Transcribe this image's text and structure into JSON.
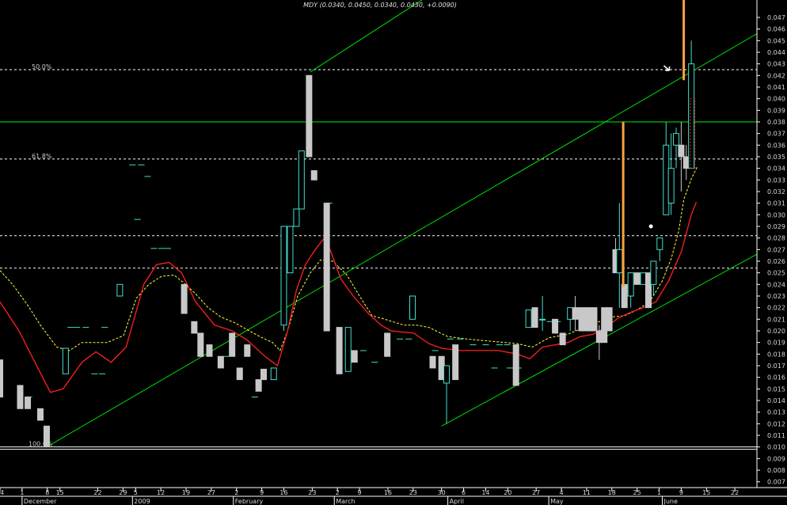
{
  "header": {
    "title": "MDY (0.0340, 0.0450, 0.0340, 0.0430, +0.0090)"
  },
  "chart_data": {
    "type": "candlestick",
    "title": "MDY (0.0340, 0.0450, 0.0340, 0.0430, +0.0090)",
    "ylim": [
      0.0065,
      0.0485
    ],
    "xlim": [
      0,
      60
    ],
    "y_ticks": [
      "0.047",
      "0.046",
      "0.045",
      "0.044",
      "0.043",
      "0.042",
      "0.041",
      "0.040",
      "0.039",
      "0.038",
      "0.037",
      "0.036",
      "0.035",
      "0.034",
      "0.033",
      "0.032",
      "0.031",
      "0.030",
      "0.029",
      "0.028",
      "0.027",
      "0.026",
      "0.025",
      "0.024",
      "0.023",
      "0.022",
      "0.021",
      "0.020",
      "0.019",
      "0.018",
      "0.017",
      "0.016",
      "0.015",
      "0.014",
      "0.013",
      "0.012",
      "0.011",
      "0.010",
      "0.009",
      "0.008",
      "0.007"
    ],
    "x_ticks": [
      {
        "label": "24",
        "x": 0
      },
      {
        "label": "1",
        "x": 1.75
      },
      {
        "label": "8",
        "x": 3.75
      },
      {
        "label": "15",
        "x": 4.75
      },
      {
        "label": "22",
        "x": 7.75
      },
      {
        "label": "29",
        "x": 9.75
      },
      {
        "label": "5",
        "x": 10.75
      },
      {
        "label": "12",
        "x": 12.75
      },
      {
        "label": "19",
        "x": 14.75
      },
      {
        "label": "27",
        "x": 16.75
      },
      {
        "label": "2",
        "x": 18.75
      },
      {
        "label": "9",
        "x": 20.75
      },
      {
        "label": "16",
        "x": 22.5
      },
      {
        "label": "23",
        "x": 24.75
      },
      {
        "label": "2",
        "x": 26.75
      },
      {
        "label": "9",
        "x": 28.5
      },
      {
        "label": "16",
        "x": 30.75
      },
      {
        "label": "23",
        "x": 32.75
      },
      {
        "label": "30",
        "x": 35
      },
      {
        "label": "6",
        "x": 36.75
      },
      {
        "label": "14",
        "x": 38.5
      },
      {
        "label": "20",
        "x": 40.25
      },
      {
        "label": "27",
        "x": 42.5
      },
      {
        "label": "4",
        "x": 44.5
      },
      {
        "label": "11",
        "x": 46.5
      },
      {
        "label": "18",
        "x": 48.5
      },
      {
        "label": "25",
        "x": 50.5
      },
      {
        "label": "1",
        "x": 52.25
      },
      {
        "label": "9",
        "x": 54
      },
      {
        "label": "15",
        "x": 56
      },
      {
        "label": "22",
        "x": 58.25
      }
    ],
    "month_labels": [
      {
        "label": "December",
        "x": 1.75
      },
      {
        "label": "2009",
        "x": 10.5
      },
      {
        "label": "February",
        "x": 18.5
      },
      {
        "label": "March",
        "x": 26.5
      },
      {
        "label": "April",
        "x": 35.5
      },
      {
        "label": "May",
        "x": 43.5
      },
      {
        "label": "June",
        "x": 52.5
      }
    ],
    "candles": [
      {
        "x": 0,
        "o": 0.0175,
        "h": 0.0175,
        "c": 0.0143,
        "l": 0.0143
      },
      {
        "x": 1.6,
        "o": 0.0153,
        "h": 0.0153,
        "c": 0.0133,
        "l": 0.0133
      },
      {
        "x": 2.2,
        "o": 0.0143,
        "h": 0.0143,
        "c": 0.0133,
        "l": 0.0133
      },
      {
        "x": 3.2,
        "o": 0.0133,
        "h": 0.0133,
        "c": 0.0123,
        "l": 0.0123
      },
      {
        "x": 3.7,
        "o": 0.0118,
        "h": 0.0118,
        "c": 0.01,
        "l": 0.01
      },
      {
        "x": 5.2,
        "o": 0.0163,
        "h": 0.0185,
        "c": 0.0185,
        "l": 0.0163
      },
      {
        "x": 9.5,
        "o": 0.023,
        "h": 0.024,
        "c": 0.024,
        "l": 0.023
      },
      {
        "x": 14.6,
        "o": 0.024,
        "h": 0.024,
        "c": 0.0215,
        "l": 0.0215
      },
      {
        "x": 15.4,
        "o": 0.0208,
        "h": 0.0208,
        "c": 0.0198,
        "l": 0.0198
      },
      {
        "x": 15.9,
        "o": 0.0198,
        "h": 0.0198,
        "c": 0.0178,
        "l": 0.0178
      },
      {
        "x": 16.6,
        "o": 0.0188,
        "h": 0.0188,
        "c": 0.0178,
        "l": 0.0178
      },
      {
        "x": 17.5,
        "o": 0.0178,
        "h": 0.0178,
        "c": 0.0168,
        "l": 0.0168
      },
      {
        "x": 18.4,
        "o": 0.0198,
        "h": 0.0198,
        "c": 0.0178,
        "l": 0.0178
      },
      {
        "x": 19.0,
        "o": 0.0168,
        "h": 0.0168,
        "c": 0.0158,
        "l": 0.0158
      },
      {
        "x": 19.6,
        "o": 0.0188,
        "h": 0.0188,
        "c": 0.0178,
        "l": 0.0178
      },
      {
        "x": 20.5,
        "o": 0.0158,
        "h": 0.0158,
        "c": 0.0148,
        "l": 0.0148
      },
      {
        "x": 20.9,
        "o": 0.0167,
        "h": 0.0167,
        "c": 0.0158,
        "l": 0.0158
      },
      {
        "x": 21.7,
        "o": 0.0158,
        "h": 0.0158,
        "c": 0.0168,
        "l": 0.0158
      },
      {
        "x": 22.5,
        "o": 0.0205,
        "h": 0.029,
        "c": 0.029,
        "l": 0.02
      },
      {
        "x": 23.0,
        "o": 0.025,
        "h": 0.029,
        "c": 0.029,
        "l": 0.025
      },
      {
        "x": 23.5,
        "o": 0.029,
        "h": 0.0305,
        "c": 0.0305,
        "l": 0.029
      },
      {
        "x": 23.9,
        "o": 0.0305,
        "h": 0.0355,
        "c": 0.0355,
        "l": 0.0305
      },
      {
        "x": 24.5,
        "o": 0.042,
        "h": 0.042,
        "c": 0.035,
        "l": 0.035
      },
      {
        "x": 24.9,
        "o": 0.0338,
        "h": 0.0338,
        "c": 0.033,
        "l": 0.033
      },
      {
        "x": 25.9,
        "o": 0.031,
        "h": 0.031,
        "c": 0.02,
        "l": 0.02
      },
      {
        "x": 26.9,
        "o": 0.0203,
        "h": 0.0203,
        "c": 0.0163,
        "l": 0.0163
      },
      {
        "x": 27.6,
        "o": 0.0165,
        "h": 0.0203,
        "c": 0.0203,
        "l": 0.0165
      },
      {
        "x": 28.1,
        "o": 0.0183,
        "h": 0.0183,
        "c": 0.0173,
        "l": 0.0173
      },
      {
        "x": 30.7,
        "o": 0.0198,
        "h": 0.0198,
        "c": 0.0178,
        "l": 0.0178
      },
      {
        "x": 32.7,
        "o": 0.021,
        "h": 0.023,
        "c": 0.023,
        "l": 0.021
      },
      {
        "x": 34.3,
        "o": 0.0178,
        "h": 0.0178,
        "c": 0.0168,
        "l": 0.0168
      },
      {
        "x": 35.0,
        "o": 0.0178,
        "h": 0.0178,
        "c": 0.0158,
        "l": 0.0158
      },
      {
        "x": 35.4,
        "o": 0.0155,
        "h": 0.017,
        "c": 0.017,
        "l": 0.012
      },
      {
        "x": 36.1,
        "o": 0.0188,
        "h": 0.0188,
        "c": 0.0158,
        "l": 0.0158
      },
      {
        "x": 40.9,
        "o": 0.0188,
        "h": 0.0188,
        "c": 0.0153,
        "l": 0.0153
      },
      {
        "x": 41.9,
        "o": 0.0203,
        "h": 0.0218,
        "c": 0.0218,
        "l": 0.0203
      },
      {
        "x": 42.4,
        "o": 0.022,
        "h": 0.022,
        "c": 0.0203,
        "l": 0.0203
      },
      {
        "x": 43.0,
        "o": 0.021,
        "h": 0.023,
        "c": 0.021,
        "l": 0.02
      },
      {
        "x": 44.0,
        "o": 0.021,
        "h": 0.021,
        "c": 0.0198,
        "l": 0.0198
      },
      {
        "x": 44.6,
        "o": 0.0198,
        "h": 0.0198,
        "c": 0.0188,
        "l": 0.0188
      },
      {
        "x": 45.2,
        "o": 0.021,
        "h": 0.022,
        "c": 0.022,
        "l": 0.02
      },
      {
        "x": 45.6,
        "o": 0.022,
        "h": 0.023,
        "c": 0.021,
        "l": 0.02
      },
      {
        "x": 46.1,
        "o": 0.022,
        "h": 0.022,
        "c": 0.02,
        "l": 0.02
      },
      {
        "x": 46.6,
        "o": 0.022,
        "h": 0.022,
        "c": 0.02,
        "l": 0.02
      },
      {
        "x": 47.1,
        "o": 0.022,
        "h": 0.022,
        "c": 0.02,
        "l": 0.02
      },
      {
        "x": 47.5,
        "o": 0.02,
        "h": 0.0205,
        "c": 0.019,
        "l": 0.0175
      },
      {
        "x": 47.9,
        "o": 0.022,
        "h": 0.022,
        "c": 0.019,
        "l": 0.019
      },
      {
        "x": 48.3,
        "o": 0.022,
        "h": 0.022,
        "c": 0.02,
        "l": 0.02
      },
      {
        "x": 48.8,
        "o": 0.027,
        "h": 0.028,
        "c": 0.025,
        "l": 0.025
      },
      {
        "x": 49.1,
        "o": 0.025,
        "h": 0.031,
        "c": 0.027,
        "l": 0.022
      },
      {
        "x": 49.5,
        "o": 0.024,
        "h": 0.024,
        "c": 0.022,
        "l": 0.022
      },
      {
        "x": 50.0,
        "o": 0.023,
        "h": 0.025,
        "c": 0.025,
        "l": 0.022
      },
      {
        "x": 50.5,
        "o": 0.025,
        "h": 0.025,
        "c": 0.024,
        "l": 0.024
      },
      {
        "x": 51.0,
        "o": 0.024,
        "h": 0.025,
        "c": 0.025,
        "l": 0.024
      },
      {
        "x": 51.4,
        "o": 0.025,
        "h": 0.025,
        "c": 0.022,
        "l": 0.022
      },
      {
        "x": 51.8,
        "o": 0.024,
        "h": 0.026,
        "c": 0.026,
        "l": 0.023
      },
      {
        "x": 52.3,
        "o": 0.027,
        "h": 0.028,
        "c": 0.028,
        "l": 0.026
      },
      {
        "x": 52.8,
        "o": 0.03,
        "h": 0.038,
        "c": 0.036,
        "l": 0.03
      },
      {
        "x": 53.2,
        "o": 0.031,
        "h": 0.037,
        "c": 0.034,
        "l": 0.03
      },
      {
        "x": 53.6,
        "o": 0.036,
        "h": 0.0375,
        "c": 0.037,
        "l": 0.034
      },
      {
        "x": 54.0,
        "o": 0.036,
        "h": 0.038,
        "c": 0.035,
        "l": 0.032
      },
      {
        "x": 54.4,
        "o": 0.035,
        "h": 0.036,
        "c": 0.034,
        "l": 0.033
      },
      {
        "x": 54.8,
        "o": 0.034,
        "h": 0.045,
        "c": 0.043,
        "l": 0.034
      }
    ],
    "dashes": [
      {
        "x": 2.3,
        "y": 0.0143
      },
      {
        "x": 5.6,
        "y": 0.0203
      },
      {
        "x": 6.1,
        "y": 0.0203
      },
      {
        "x": 6.8,
        "y": 0.0203
      },
      {
        "x": 8.3,
        "y": 0.0203
      },
      {
        "x": 7.5,
        "y": 0.0163
      },
      {
        "x": 8.1,
        "y": 0.0163
      },
      {
        "x": 10.5,
        "y": 0.0343
      },
      {
        "x": 11.2,
        "y": 0.0343
      },
      {
        "x": 11.7,
        "y": 0.0333
      },
      {
        "x": 10.9,
        "y": 0.0296
      },
      {
        "x": 12.2,
        "y": 0.0271
      },
      {
        "x": 12.8,
        "y": 0.0271
      },
      {
        "x": 13.3,
        "y": 0.0271
      },
      {
        "x": 17.9,
        "y": 0.0178
      },
      {
        "x": 20.2,
        "y": 0.0143
      },
      {
        "x": 26.1,
        "y": 0.031
      },
      {
        "x": 28.8,
        "y": 0.0183
      },
      {
        "x": 29.7,
        "y": 0.0173
      },
      {
        "x": 31.7,
        "y": 0.0193
      },
      {
        "x": 32.4,
        "y": 0.0193
      },
      {
        "x": 34.5,
        "y": 0.0183
      },
      {
        "x": 35.7,
        "y": 0.0193
      },
      {
        "x": 36.5,
        "y": 0.0193
      },
      {
        "x": 37.5,
        "y": 0.0188
      },
      {
        "x": 38.5,
        "y": 0.0188
      },
      {
        "x": 39.6,
        "y": 0.0188
      },
      {
        "x": 40.2,
        "y": 0.0188
      },
      {
        "x": 41.1,
        "y": 0.0168
      },
      {
        "x": 39.2,
        "y": 0.0168
      },
      {
        "x": 40.4,
        "y": 0.0168
      },
      {
        "x": 43.6,
        "y": 0.0208
      },
      {
        "x": 44.2,
        "y": 0.0208
      }
    ],
    "ma_red": [
      [
        0,
        0.0225
      ],
      [
        1.5,
        0.02
      ],
      [
        3,
        0.0168
      ],
      [
        4,
        0.0147
      ],
      [
        5,
        0.015
      ],
      [
        6.5,
        0.0173
      ],
      [
        7.6,
        0.0182
      ],
      [
        8.8,
        0.0173
      ],
      [
        10,
        0.0186
      ],
      [
        11.4,
        0.024
      ],
      [
        12.4,
        0.0257
      ],
      [
        13.4,
        0.0259
      ],
      [
        14.4,
        0.025
      ],
      [
        15.5,
        0.0225
      ],
      [
        17,
        0.0205
      ],
      [
        18.4,
        0.02
      ],
      [
        19.6,
        0.0192
      ],
      [
        21,
        0.0178
      ],
      [
        22,
        0.017
      ],
      [
        22.8,
        0.02
      ],
      [
        23.5,
        0.0235
      ],
      [
        24.2,
        0.0257
      ],
      [
        25,
        0.027
      ],
      [
        25.7,
        0.028
      ],
      [
        26.2,
        0.0269
      ],
      [
        27,
        0.0245
      ],
      [
        28,
        0.023
      ],
      [
        29.2,
        0.0215
      ],
      [
        30.2,
        0.0205
      ],
      [
        31,
        0.02
      ],
      [
        32.8,
        0.0198
      ],
      [
        34,
        0.0189
      ],
      [
        35,
        0.0185
      ],
      [
        36.5,
        0.0183
      ],
      [
        38,
        0.0183
      ],
      [
        39.5,
        0.0183
      ],
      [
        41,
        0.018
      ],
      [
        42,
        0.0176
      ],
      [
        43,
        0.0186
      ],
      [
        44,
        0.0188
      ],
      [
        45,
        0.019
      ],
      [
        46,
        0.0195
      ],
      [
        47,
        0.0197
      ],
      [
        48,
        0.0203
      ],
      [
        49,
        0.0211
      ],
      [
        50,
        0.0216
      ],
      [
        51,
        0.022
      ],
      [
        52,
        0.0225
      ],
      [
        53,
        0.0243
      ],
      [
        54,
        0.0268
      ],
      [
        54.8,
        0.03
      ],
      [
        55.2,
        0.0311
      ]
    ],
    "ma_yellow": [
      [
        0,
        0.0252
      ],
      [
        1,
        0.024
      ],
      [
        2.2,
        0.0222
      ],
      [
        3.2,
        0.0205
      ],
      [
        4.5,
        0.0186
      ],
      [
        5.5,
        0.0183
      ],
      [
        6.5,
        0.019
      ],
      [
        7.5,
        0.019
      ],
      [
        8.5,
        0.019
      ],
      [
        9.8,
        0.0196
      ],
      [
        10.8,
        0.0228
      ],
      [
        11.8,
        0.024
      ],
      [
        12.8,
        0.0247
      ],
      [
        13.8,
        0.0248
      ],
      [
        14.5,
        0.0242
      ],
      [
        15.5,
        0.0232
      ],
      [
        16.5,
        0.022
      ],
      [
        17.5,
        0.0212
      ],
      [
        18.6,
        0.0207
      ],
      [
        19.6,
        0.0201
      ],
      [
        20.6,
        0.0195
      ],
      [
        21.6,
        0.019
      ],
      [
        22.2,
        0.0183
      ],
      [
        22.8,
        0.02
      ],
      [
        23.6,
        0.023
      ],
      [
        24.6,
        0.025
      ],
      [
        25.4,
        0.0261
      ],
      [
        26.4,
        0.026
      ],
      [
        27.5,
        0.0248
      ],
      [
        28.5,
        0.023
      ],
      [
        29.5,
        0.0213
      ],
      [
        30.5,
        0.021
      ],
      [
        32,
        0.0205
      ],
      [
        33,
        0.0205
      ],
      [
        34,
        0.0203
      ],
      [
        35.5,
        0.0195
      ],
      [
        37,
        0.0193
      ],
      [
        39,
        0.0191
      ],
      [
        41,
        0.0189
      ],
      [
        42.2,
        0.0186
      ],
      [
        43.5,
        0.0194
      ],
      [
        45,
        0.0197
      ],
      [
        46.3,
        0.0203
      ],
      [
        47.5,
        0.0208
      ],
      [
        48.5,
        0.0212
      ],
      [
        49.5,
        0.0213
      ],
      [
        50.5,
        0.0218
      ],
      [
        51.5,
        0.0225
      ],
      [
        52.5,
        0.0243
      ],
      [
        53.2,
        0.0262
      ],
      [
        53.8,
        0.0286
      ],
      [
        54.2,
        0.0313
      ],
      [
        54.8,
        0.0331
      ],
      [
        55.3,
        0.0342
      ]
    ],
    "fib_lines": [
      {
        "label": "50.0%",
        "y": 0.0425,
        "color": "#ffffff",
        "style": "dashed"
      },
      {
        "label": "61.8%",
        "y": 0.0348,
        "color": "#ffffff",
        "style": "dashed"
      },
      {
        "label": "100.0%",
        "y": 0.01,
        "color": "#ffffff",
        "style": "solid"
      }
    ],
    "h_lines": [
      {
        "y": 0.0282,
        "color": "#ffffff",
        "style": "dashed"
      },
      {
        "y": 0.0254,
        "color": "#ffffff",
        "style": "dashed"
      },
      {
        "y": 0.038,
        "color": "#00ee00",
        "style": "solid"
      }
    ],
    "trend_lines": [
      {
        "x1": 3.7,
        "y1": 0.01,
        "x2": 60,
        "y2": 0.0456,
        "color": "#00dd00"
      },
      {
        "x1": 24.6,
        "y1": 0.0423,
        "x2": 37,
        "y2": 0.051,
        "color": "#00dd00"
      },
      {
        "x1": 35,
        "y1": 0.0118,
        "x2": 60,
        "y2": 0.0266,
        "color": "#00dd00"
      }
    ],
    "orange_bars": [
      {
        "x": 49.4,
        "y1": 0.038,
        "y2": 0.0238
      },
      {
        "x": 54.2,
        "y1": 0.05,
        "y2": 0.0416
      }
    ],
    "red_dotted_box": {
      "x": 54.9,
      "y1": 0.04,
      "y2": 0.034
    },
    "white_dot": {
      "x": 51.6,
      "y": 0.029
    },
    "arrow_marker": {
      "x": 53.0,
      "y": 0.0425
    }
  },
  "colors": {
    "background": "#000000",
    "candle_gray": "#c8c8c8",
    "candle_cyan": "#40e0d0",
    "ma_red": "#ff2020",
    "ma_yellow": "#ffff40",
    "trend_green": "#00dd00",
    "orange": "#ffa040"
  }
}
